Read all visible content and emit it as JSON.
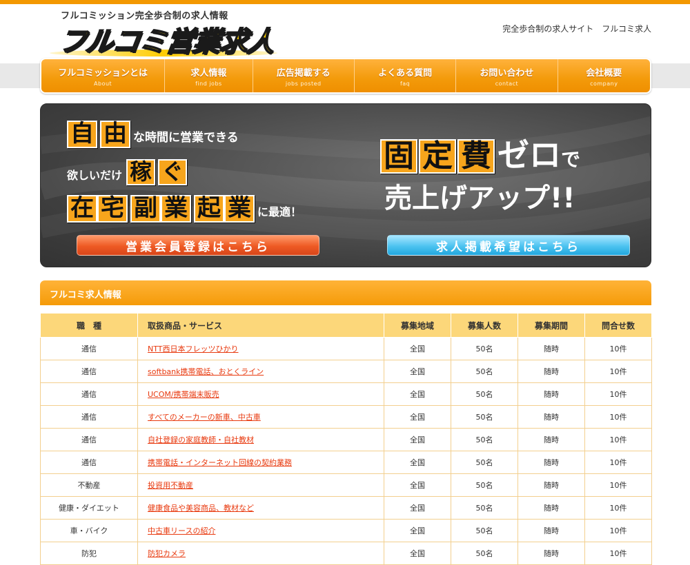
{
  "header": {
    "logo_subtitle": "フルコミッション完全歩合制の求人情報",
    "logo_text": "フルコミ営業求人",
    "tagline": "完全歩合制の求人サイト　フルコミ求人"
  },
  "nav": [
    {
      "label": "フルコミッションとは",
      "sub": "About"
    },
    {
      "label": "求人情報",
      "sub": "find jobs"
    },
    {
      "label": "広告掲載する",
      "sub": "jobs posted"
    },
    {
      "label": "よくある質問",
      "sub": "faq"
    },
    {
      "label": "お問い合わせ",
      "sub": "contact"
    },
    {
      "label": "会社概要",
      "sub": "company"
    }
  ],
  "banner": {
    "line1_big": [
      "自",
      "由"
    ],
    "line1_small": "な時間に営業できる",
    "line2_small": "欲しいだけ",
    "line2_big": [
      "稼",
      "ぐ"
    ],
    "line3_big_a": [
      "在",
      "宅"
    ],
    "line3_big_b": [
      "副",
      "業"
    ],
    "line3_big_c": [
      "起",
      "業"
    ],
    "line3_small": "に最適！",
    "right_big": [
      "固",
      "定",
      "費"
    ],
    "right_rest": "ゼロ",
    "right_de": "で",
    "right_line2": "売上げアップ!!",
    "btn_member": "営業会員登録はこちら",
    "btn_post": "求人掲載希望はこちら"
  },
  "section_title": "フルコミ求人情報",
  "table": {
    "headers": [
      "職　種",
      "取扱商品・サービス",
      "募集地域",
      "募集人数",
      "募集期間",
      "問合せ数"
    ],
    "rows": [
      [
        "通信",
        "NTT西日本フレッツひかり",
        "全国",
        "50名",
        "随時",
        "10件"
      ],
      [
        "通信",
        "softbank携帯電話、おとくライン",
        "全国",
        "50名",
        "随時",
        "10件"
      ],
      [
        "通信",
        "UCOM/携帯端末販売",
        "全国",
        "50名",
        "随時",
        "10件"
      ],
      [
        "通信",
        "すべてのメーカーの新車、中古車",
        "全国",
        "50名",
        "随時",
        "10件"
      ],
      [
        "通信",
        "自社登録の家庭教師・自社教材",
        "全国",
        "50名",
        "随時",
        "10件"
      ],
      [
        "通信",
        "携帯電話・インターネット回線の契約業務",
        "全国",
        "50名",
        "随時",
        "10件"
      ],
      [
        "不動産",
        "投資用不動産",
        "全国",
        "50名",
        "随時",
        "10件"
      ],
      [
        "健康・ダイエット",
        "健康食品や美容商品、教材など",
        "全国",
        "50名",
        "随時",
        "10件"
      ],
      [
        "車・バイク",
        "中古車リースの紹介",
        "全国",
        "50名",
        "随時",
        "10件"
      ],
      [
        "防犯",
        "防犯カメラ",
        "全国",
        "50名",
        "随時",
        "10件"
      ]
    ]
  }
}
